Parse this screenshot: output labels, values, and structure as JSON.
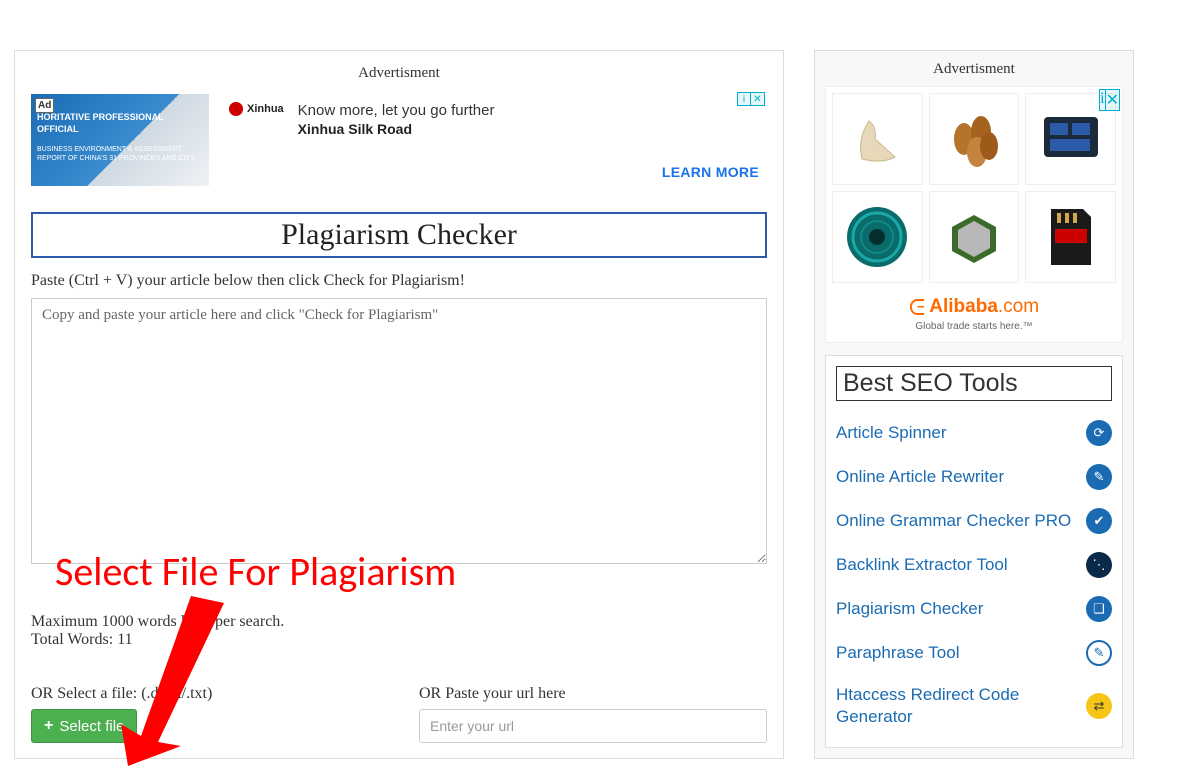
{
  "main": {
    "ad_label": "Advertisment",
    "ad": {
      "badge": "Ad",
      "thumb_line1": "HORITATIVE PROFESSIONAL OFFICIAL",
      "thumb_line2": "BUSINESS ENVIRONMENT & ASSESSMENT REPORT OF CHINA'S 31 PROVINCES AND CITY",
      "logo_text": "Xinhua",
      "headline": "Know more, let you go further",
      "subline": "Xinhua Silk Road",
      "cta": "LEARN MORE"
    },
    "title": "Plagiarism Checker",
    "instruction": "Paste (Ctrl + V) your article below then click Check for Plagiarism!",
    "textarea_placeholder": "Copy and paste your article here and click \"Check for Plagiarism\"",
    "limit_text": "Maximum 1000 words limit per search.",
    "total_words_label": "Total Words: ",
    "total_words_value": "11",
    "file_label": "OR Select a file: (.docx/.txt)",
    "select_file_btn": "Select file",
    "url_label": "OR Paste your url here",
    "url_placeholder": "Enter your url",
    "annotation_text": "Select File For Plagiarism"
  },
  "sidebar": {
    "ad_label": "Advertisment",
    "alibaba_brand_pre": "Alibaba",
    "alibaba_brand_suf": ".com",
    "alibaba_tag": "Global trade starts here.™",
    "tools_title": "Best SEO Tools",
    "tools": [
      {
        "label": "Article Spinner"
      },
      {
        "label": "Online Article Rewriter"
      },
      {
        "label": "Online Grammar Checker PRO"
      },
      {
        "label": "Backlink Extractor Tool"
      },
      {
        "label": "Plagiarism Checker"
      },
      {
        "label": "Paraphrase Tool"
      },
      {
        "label": "Htaccess Redirect Code Generator"
      }
    ]
  }
}
